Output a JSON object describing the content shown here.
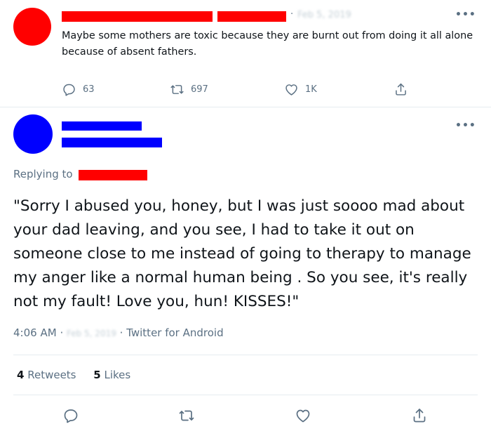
{
  "tweet1": {
    "timestamp": "Feb 5, 2019",
    "text": "Maybe some mothers are toxic because they are burnt out from doing it all alone because of absent fathers.",
    "replies": "63",
    "retweets": "697",
    "likes": "1K",
    "more": "•••"
  },
  "tweet2": {
    "more": "•••",
    "replying_prefix": "Replying to",
    "text": "\"Sorry I abused you, honey, but I was just soooo mad about your dad leaving, and you see, I had to take it out on someone close to me instead of going to therapy to manage my anger like a normal human being . So you see, it's really not my fault! Love you, hun! KISSES!\"",
    "time": "4:06 AM",
    "date": "Feb 5, 2019",
    "source": "Twitter for Android",
    "retweets_count": "4",
    "retweets_label": "Retweets",
    "likes_count": "5",
    "likes_label": "Likes"
  },
  "colors": {
    "redaction_red": "#ff0000",
    "redaction_blue": "#0000ff",
    "secondary_text": "#5b7083"
  }
}
